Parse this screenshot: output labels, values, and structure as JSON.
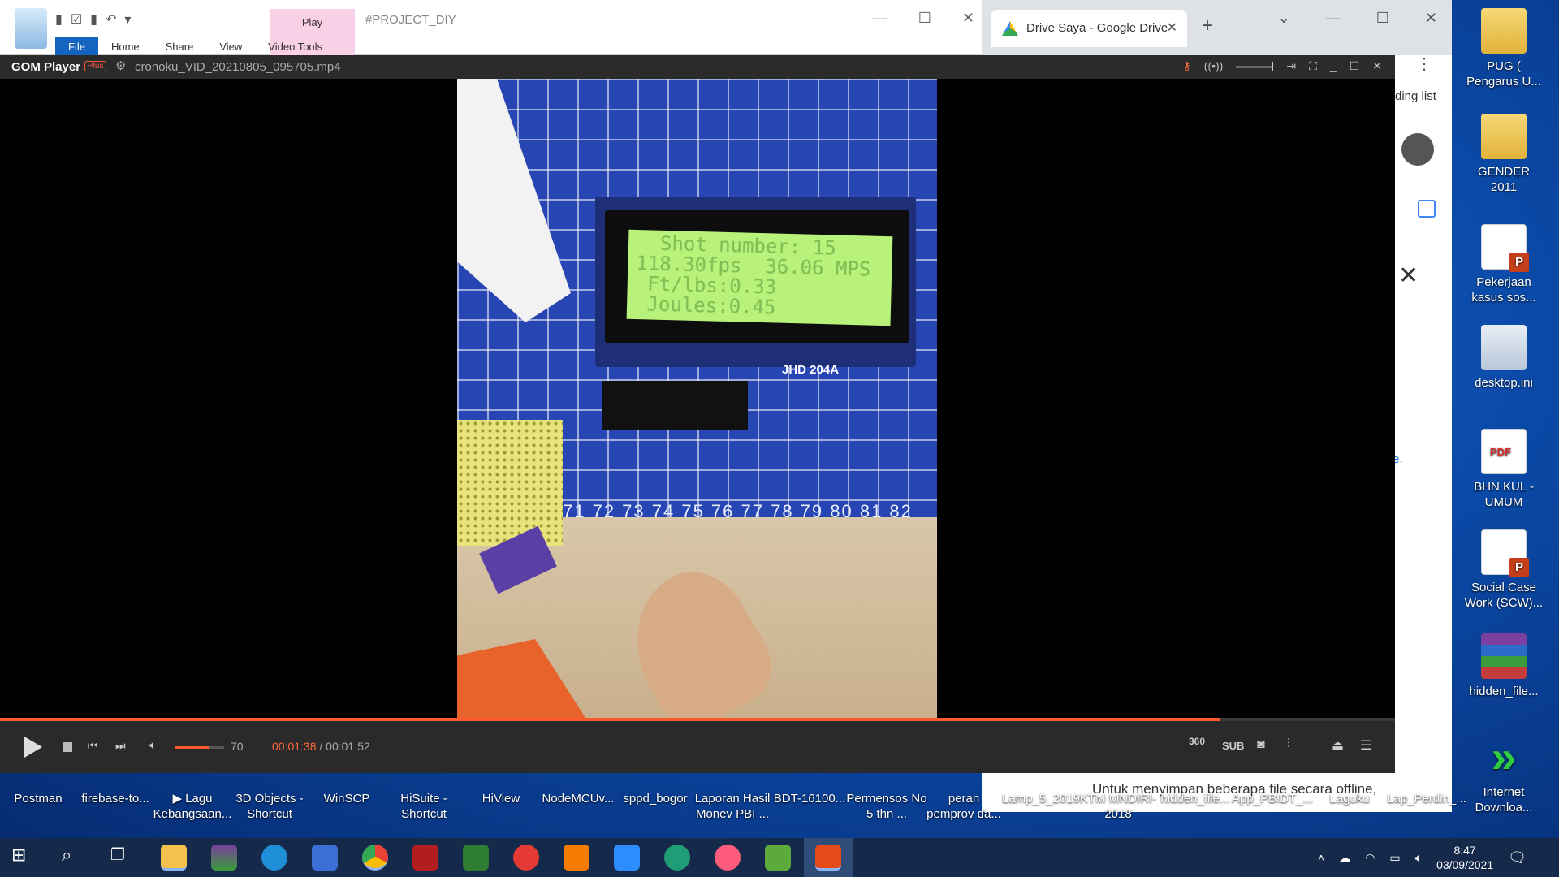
{
  "explorer": {
    "title": "#PROJECT_DIY",
    "ribbon_tabs": [
      "File",
      "Home",
      "Share",
      "View",
      "Video Tools"
    ],
    "context_tab": "Play"
  },
  "chrome": {
    "tab_title": "Drive Saya - Google Drive",
    "side_text_1": "ding list",
    "side_text_2": "e.",
    "footer_message": "Untuk menyimpan beberapa file secara offline,"
  },
  "gom": {
    "brand": "GOM Player",
    "plus_badge": "Plus",
    "file_name": "cronoku_VID_20210805_095705.mp4",
    "volume": "70",
    "time_current": "00:01:38",
    "time_separator": " / ",
    "time_total": "00:01:52",
    "progress_fraction": 0.875,
    "volume_fraction": 0.7,
    "btn_360": "360",
    "btn_sub": "SUB",
    "lcd_lines": [
      "  Shot number: 15",
      "118.30fps  36.06 MPS",
      " Ft/lbs:0.33",
      " Joules:0.45"
    ],
    "lcd_brand": "JHD 204A",
    "ruler_text": "71 72 73 74 75 76 77 78 79 80 81 82"
  },
  "desktop_right": [
    {
      "label": "PUG ( Pengarus U...",
      "icon": "folder-icon"
    },
    {
      "label": "GENDER 2011",
      "icon": "folder-icon"
    },
    {
      "label": "Pekerjaan kasus sos...",
      "icon": "powerpoint-icon"
    },
    {
      "label": "desktop.ini",
      "icon": "settings-file-icon"
    },
    {
      "label": "BHN KUL -UMUM",
      "icon": "pdf-icon"
    },
    {
      "label": "Social Case Work (SCW)...",
      "icon": "powerpoint-icon"
    },
    {
      "label": "hidden_file...",
      "icon": "winrar-icon"
    },
    {
      "label": "Internet Downloa...",
      "icon": "idm-icon"
    }
  ],
  "desktop_bottom": [
    "Postman",
    "firebase-to...",
    "▶ Lagu Kebangsaan...",
    "3D Objects - Shortcut",
    "WinSCP",
    "HiSuite - Shortcut",
    "HiView",
    "NodeMCUv...",
    "sppd_bogor",
    "Laporan Hasil Monev PBI ...",
    "BDT-16100...",
    "Permensos No 5 thn ...",
    "peran pemprov da...",
    "Lamp_5_2019",
    "KTM MNDIRI-2018",
    "hidden_file...",
    "App_PBIDT_...",
    "Laguku",
    "Lap_Perdin_..."
  ],
  "taskbar": {
    "time": "8:47",
    "date": "03/09/2021"
  }
}
